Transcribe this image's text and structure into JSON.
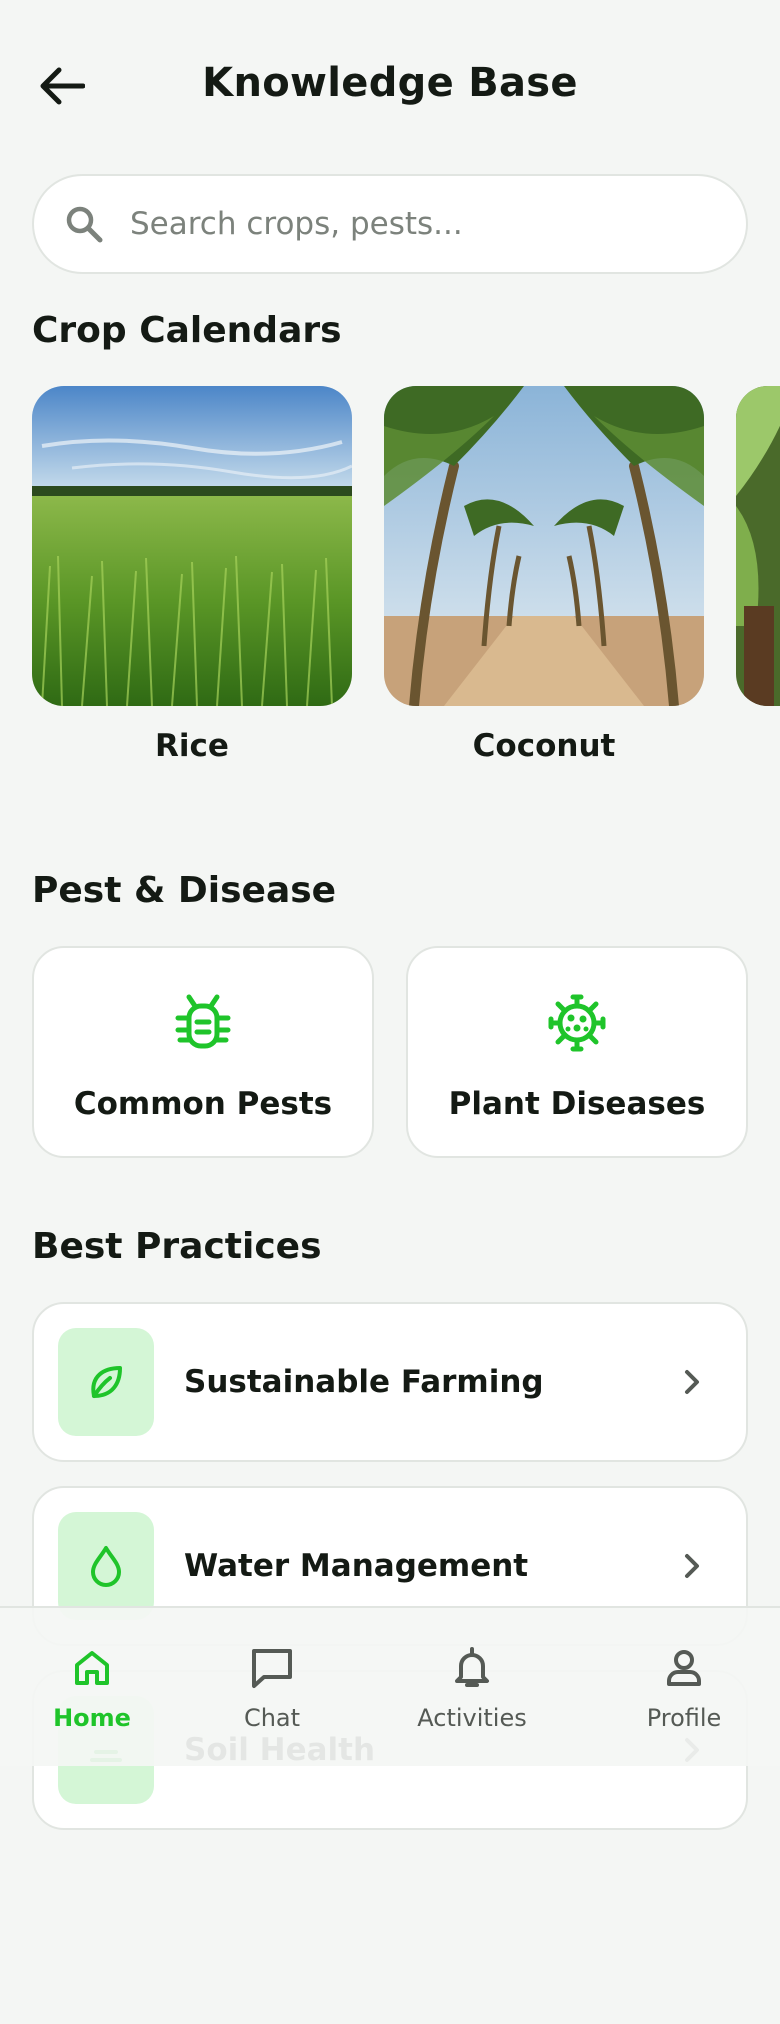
{
  "header": {
    "title": "Knowledge Base",
    "back_icon": "arrow-left-icon"
  },
  "search": {
    "placeholder": "Search crops, pests...",
    "value": "",
    "icon": "search-icon"
  },
  "crop_calendars": {
    "title": "Crop Calendars",
    "items": [
      {
        "label": "Rice",
        "image": "rice-field-photo"
      },
      {
        "label": "Coconut",
        "image": "coconut-grove-photo"
      },
      {
        "label": "",
        "image": "banana-plant-photo"
      }
    ]
  },
  "pest_disease": {
    "title": "Pest & Disease",
    "items": [
      {
        "label": "Common Pests",
        "icon": "bug-icon"
      },
      {
        "label": "Plant Diseases",
        "icon": "virus-icon"
      }
    ]
  },
  "best_practices": {
    "title": "Best Practices",
    "items": [
      {
        "label": "Sustainable Farming",
        "icon": "leaf-icon"
      },
      {
        "label": "Water Management",
        "icon": "water-drop-icon"
      },
      {
        "label": "Soil Health",
        "icon": "soil-icon"
      }
    ]
  },
  "bottom_nav": {
    "items": [
      {
        "label": "Home",
        "icon": "home-icon",
        "active": true
      },
      {
        "label": "Chat",
        "icon": "chat-icon",
        "active": false
      },
      {
        "label": "Activities",
        "icon": "bell-icon",
        "active": false
      },
      {
        "label": "Profile",
        "icon": "user-icon",
        "active": false
      }
    ]
  },
  "colors": {
    "accent": "#1fc42a",
    "accent_soft": "#d4f6d6",
    "background": "#f4f6f4",
    "card": "#ffffff",
    "text": "#141a14",
    "muted": "#555a55"
  }
}
